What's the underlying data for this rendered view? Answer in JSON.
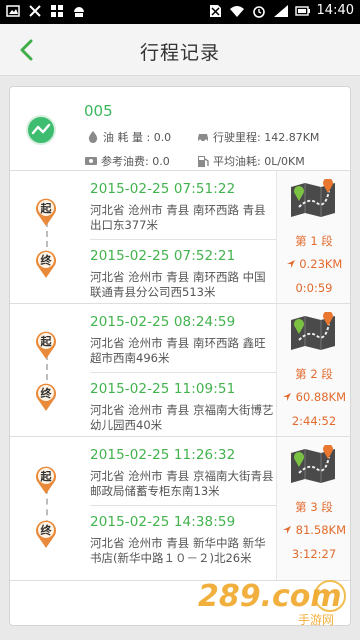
{
  "status_bar": {
    "time": "14:40"
  },
  "header": {
    "title": "行程记录"
  },
  "summary": {
    "trip_number": "005",
    "fuel_consumption": "油 耗 量 : 0.0",
    "distance": "行驶里程: 142.87KM",
    "reference_cost": "参考油费: 0.0",
    "average_fuel": "平均油耗: 0L/0KM"
  },
  "trips": [
    {
      "start_marker": "起",
      "end_marker": "终",
      "start_time": "2015-02-25 07:51:22",
      "start_address": "河北省 沧州市 青县 南环西路 青县出口东377米",
      "end_time": "2015-02-25 07:52:21",
      "end_address": "河北省 沧州市 青县 南环西路 中国联通青县分公司西513米",
      "segment": "第 1 段",
      "distance": "0.23KM",
      "duration": "0:0:59"
    },
    {
      "start_marker": "起",
      "end_marker": "终",
      "start_time": "2015-02-25 08:24:59",
      "start_address": "河北省 沧州市 青县 南环西路 鑫旺超市西南496米",
      "end_time": "2015-02-25 11:09:51",
      "end_address": "河北省 沧州市 青县 京福南大街博艺幼儿园西40米",
      "segment": "第 2 段",
      "distance": "60.88KM",
      "duration": "2:44:52"
    },
    {
      "start_marker": "起",
      "end_marker": "终",
      "start_time": "2015-02-25 11:26:32",
      "start_address": "河北省 沧州市 青县 京福南大街青县邮政局储蓄专柜东南13米",
      "end_time": "2015-02-25 14:38:59",
      "end_address": "河北省 沧州市 青县 新华中路 新华书店(新华中路１０－２)北26米",
      "segment": "第 3 段",
      "distance": "81.58KM",
      "duration": "3:12:27"
    }
  ],
  "watermark": {
    "text": "289.com",
    "subtext": "手游网"
  },
  "colors": {
    "green": "#42b34d",
    "orange": "#e26a2c",
    "map_dark": "#4a4a4a"
  }
}
